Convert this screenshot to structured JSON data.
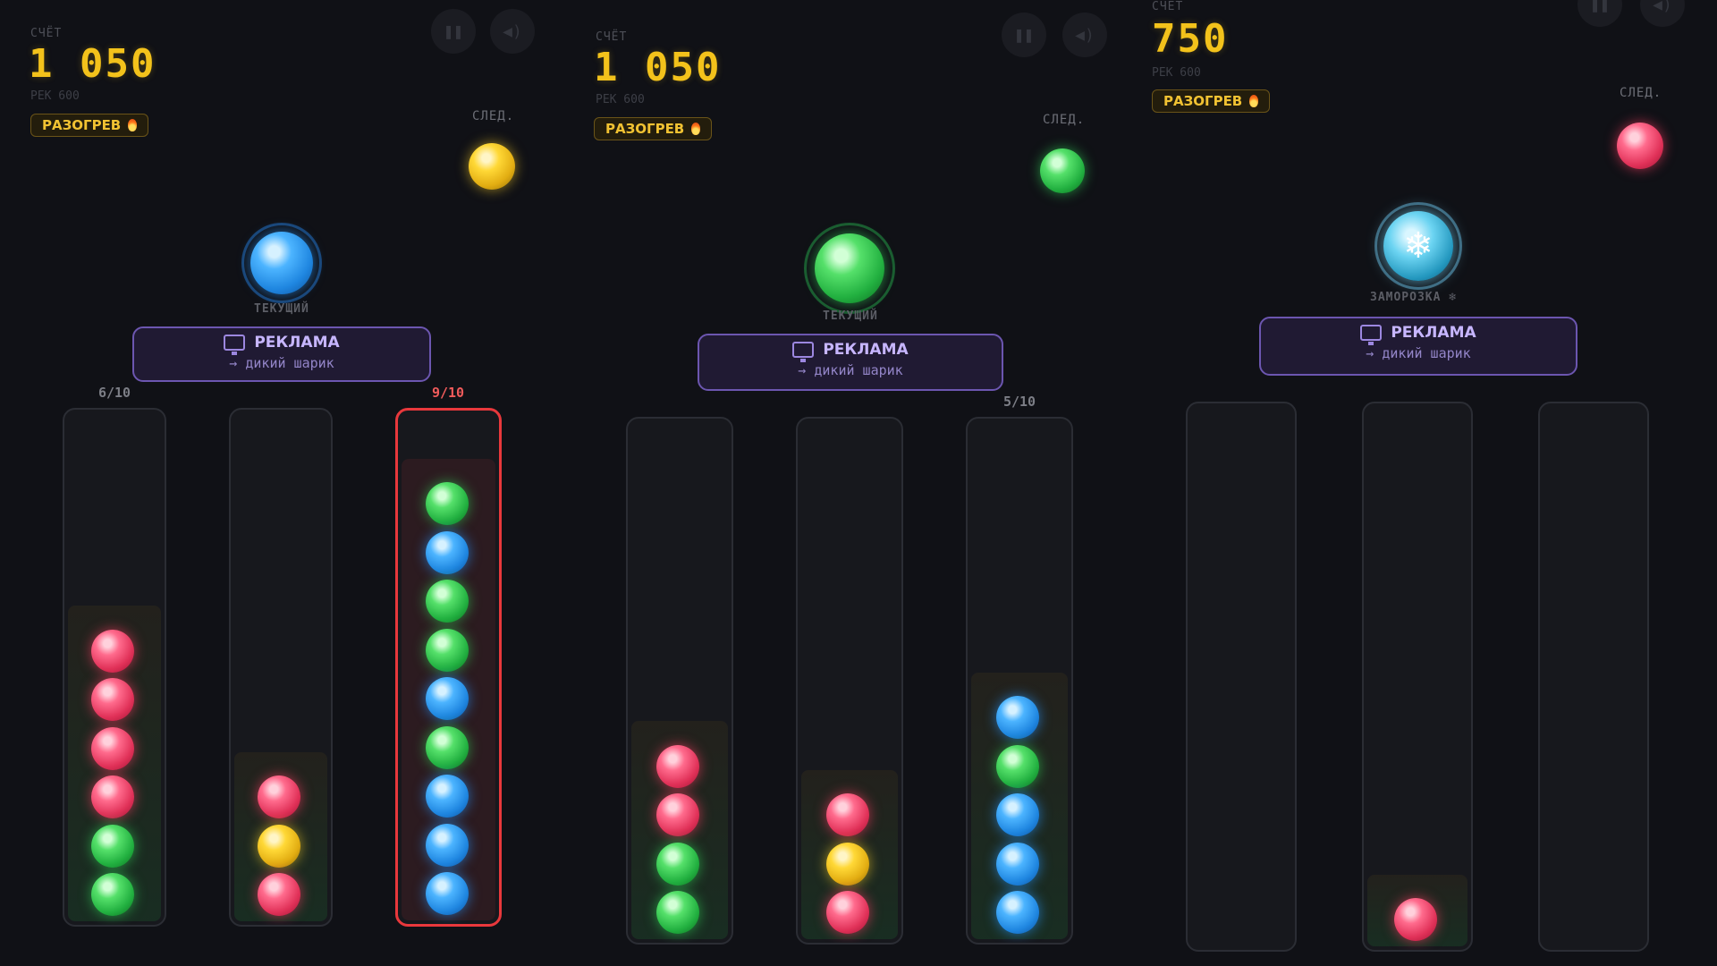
{
  "panels": [
    {
      "score_label": "СЧЁТ",
      "score": "1 050",
      "record": "РЕК 600",
      "badge": "РАЗОГРЕВ",
      "next_label": "СЛЕД.",
      "next_ball": "yellow",
      "current_label": "ТЕКУЩИЙ",
      "current_ball": "blue",
      "ad": {
        "title": "РЕКЛАМА",
        "subtitle": "→ дикий шарик"
      },
      "tubes": [
        {
          "count": "6/10",
          "balls": [
            "red",
            "red",
            "red",
            "red",
            "green",
            "green"
          ]
        },
        {
          "count": "",
          "balls": [
            "red",
            "yellow",
            "red"
          ]
        },
        {
          "count": "9/10",
          "balls": [
            "green",
            "blue",
            "green",
            "green",
            "blue",
            "green",
            "blue",
            "blue",
            "blue"
          ],
          "full": true
        }
      ]
    },
    {
      "score_label": "СЧЁТ",
      "score": "1 050",
      "record": "РЕК 600",
      "badge": "РАЗОГРЕВ",
      "next_label": "СЛЕД.",
      "next_ball": "green",
      "current_label": "ТЕКУЩИЙ",
      "current_ball": "green",
      "ad": {
        "title": "РЕКЛАМА",
        "subtitle": "→ дикий шарик"
      },
      "tubes": [
        {
          "count": "",
          "balls": [
            "red",
            "red",
            "green",
            "green"
          ]
        },
        {
          "count": "",
          "balls": [
            "red",
            "yellow",
            "red"
          ]
        },
        {
          "count": "5/10",
          "balls": [
            "blue",
            "green",
            "blue",
            "blue",
            "blue"
          ]
        }
      ]
    },
    {
      "score_label": "СЧЁТ",
      "score": "750",
      "record": "РЕК 600",
      "badge": "РАЗОГРЕВ",
      "next_label": "СЛЕД.",
      "next_ball": "red",
      "current_label": "ЗАМОРОЗКА ❄",
      "current_ball": "freeze",
      "ad": {
        "title": "РЕКЛАМА",
        "subtitle": "→ дикий шарик"
      },
      "tubes": [
        {
          "count": "",
          "balls": []
        },
        {
          "count": "",
          "balls": [
            "red"
          ]
        },
        {
          "count": "",
          "balls": []
        }
      ]
    }
  ],
  "icons": {
    "pause": "pause-icon",
    "sound": "sound-icon",
    "fire": "fire-icon",
    "ad": "tv-icon",
    "freeze": "snowflake-icon"
  },
  "colors": {
    "red": "#e03158",
    "green": "#22b040",
    "blue": "#1f86e0",
    "yellow": "#e2ad12",
    "score": "#f3c21b",
    "ad_border": "#6c56b0",
    "alert": "#e8383c"
  }
}
